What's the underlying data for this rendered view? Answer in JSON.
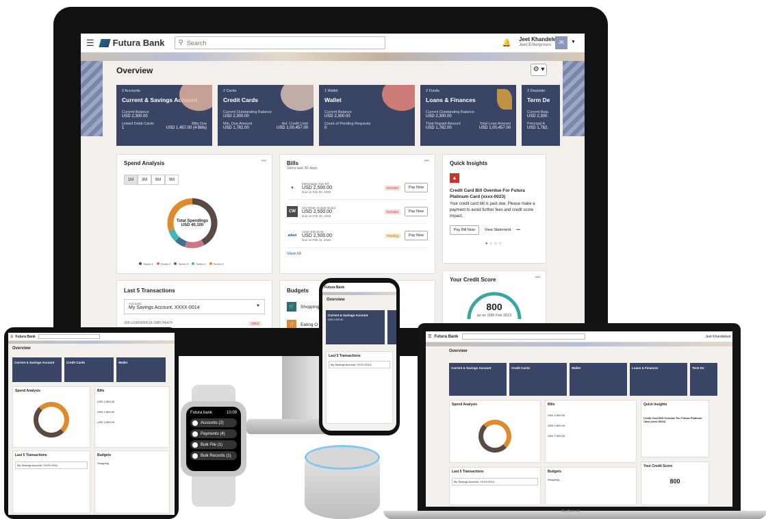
{
  "header": {
    "brand": "Futura Bank",
    "search_placeholder": "Search",
    "user_name": "Jeet Khandelwal",
    "user_org": "Jeet Enterprises",
    "avatar_initials": "JK"
  },
  "overview": {
    "title": "Overview",
    "accounts": [
      {
        "count": "2 Accounts",
        "title": "Current & Savings Account",
        "l1": "Current Balance",
        "v1": "USD 2,300.00",
        "l2": "Linked Debit Cards",
        "l3": "Bills Due",
        "v2": "1",
        "v3": "USD 1,457.00 (4 Bills)"
      },
      {
        "count": "2 Cards",
        "title": "Credit Cards",
        "l1": "Current Outstanding Balance",
        "v1": "USD 2,300.00",
        "l2": "Min. Due Amount",
        "l3": "Avl. Credit Limit",
        "v2": "USD 1,782.00",
        "v3": "USD 1,00,457.00"
      },
      {
        "count": "1 Wallet",
        "title": "Wallet",
        "l1": "Current Balance",
        "v1": "USD 2,300.00",
        "l2": "Count of Pending Requests",
        "l3": "",
        "v2": "0",
        "v3": ""
      },
      {
        "count": "2 Funds",
        "title": "Loans & Finances",
        "l1": "Current Outstanding Balance",
        "v1": "USD 2,300.00",
        "l2": "Total Repaid Amount",
        "l3": "Total Loan Amount",
        "v2": "USD 1,782.00",
        "v3": "USD 1,00,457.00"
      },
      {
        "count": "2 Deposits",
        "title": "Term De",
        "l1": "Current Bala",
        "v1": "USD 2,300.",
        "l2": "Principal A",
        "l3": "",
        "v2": "USD 1,782.",
        "v3": ""
      }
    ]
  },
  "spend": {
    "title": "Spend Analysis",
    "ranges": [
      "1M",
      "3M",
      "6M",
      "9M"
    ],
    "center_label": "Total Spendings",
    "center_value": "USD 40,100",
    "legend": [
      "Series 1",
      "Series 2",
      "Series 3",
      "Series 4",
      "Series 5"
    ],
    "colors": [
      "#5a4a42",
      "#c77a86",
      "#3f6f8a",
      "#4ab3b5",
      "#e08a2e"
    ],
    "shares": [
      0.42,
      0.13,
      0.07,
      0.08,
      0.3
    ]
  },
  "bills": {
    "title": "Bills",
    "subtitle": "Since last 30 days",
    "items": [
      {
        "name": "Mahanagar Gas Bill",
        "amount": "USD 2,500.00",
        "due": "Due on Feb 20, 2025",
        "status": "Overdue",
        "btn": "Pay Now",
        "icon": "MG"
      },
      {
        "name": "City Water Supply Board",
        "amount": "USD 2,500.00",
        "due": "Due on Feb 20, 2025",
        "status": "Overdue",
        "btn": "Pay Now",
        "icon": "CW"
      },
      {
        "name": "Adani Electricity",
        "amount": "USD 2,500.00",
        "due": "Due on Feb 11, 2025",
        "status": "Pending",
        "btn": "Pay Now",
        "icon": "adani"
      }
    ],
    "view_all": "View All"
  },
  "insights": {
    "title": "Quick Insights",
    "headline": "Credit Card Bill Overdue For Futura Platinum Card (xxxx-0023)",
    "body": "Your credit card bill is past due. Please make a payment to avoid further fees and credit score impact.",
    "pay_btn": "Pay Bill Now",
    "view_btn": "View Statement",
    "more": "•••",
    "pager": "●○○○"
  },
  "transactions": {
    "title": "Last 5 Transactions",
    "account_label": "Accounts",
    "account_value": "My Savings Account, XXXX-0014",
    "row_ref": "358-U1980000618-3385746474",
    "row_tag": "Debit"
  },
  "budgets": {
    "title": "Budgets",
    "item1": "Shopping",
    "item2": "Eating O"
  },
  "credit": {
    "title": "Your Credit Score",
    "score": "800",
    "asof": "as on 20th Feb 2023"
  },
  "watch": {
    "brand": "Futura bank",
    "time": "10:09",
    "items": [
      "Accounts (2)",
      "Payments (4)",
      "Bulk File (1)",
      "Bulk Records (1)"
    ]
  },
  "laptop": {
    "label": "MacBook Air"
  }
}
